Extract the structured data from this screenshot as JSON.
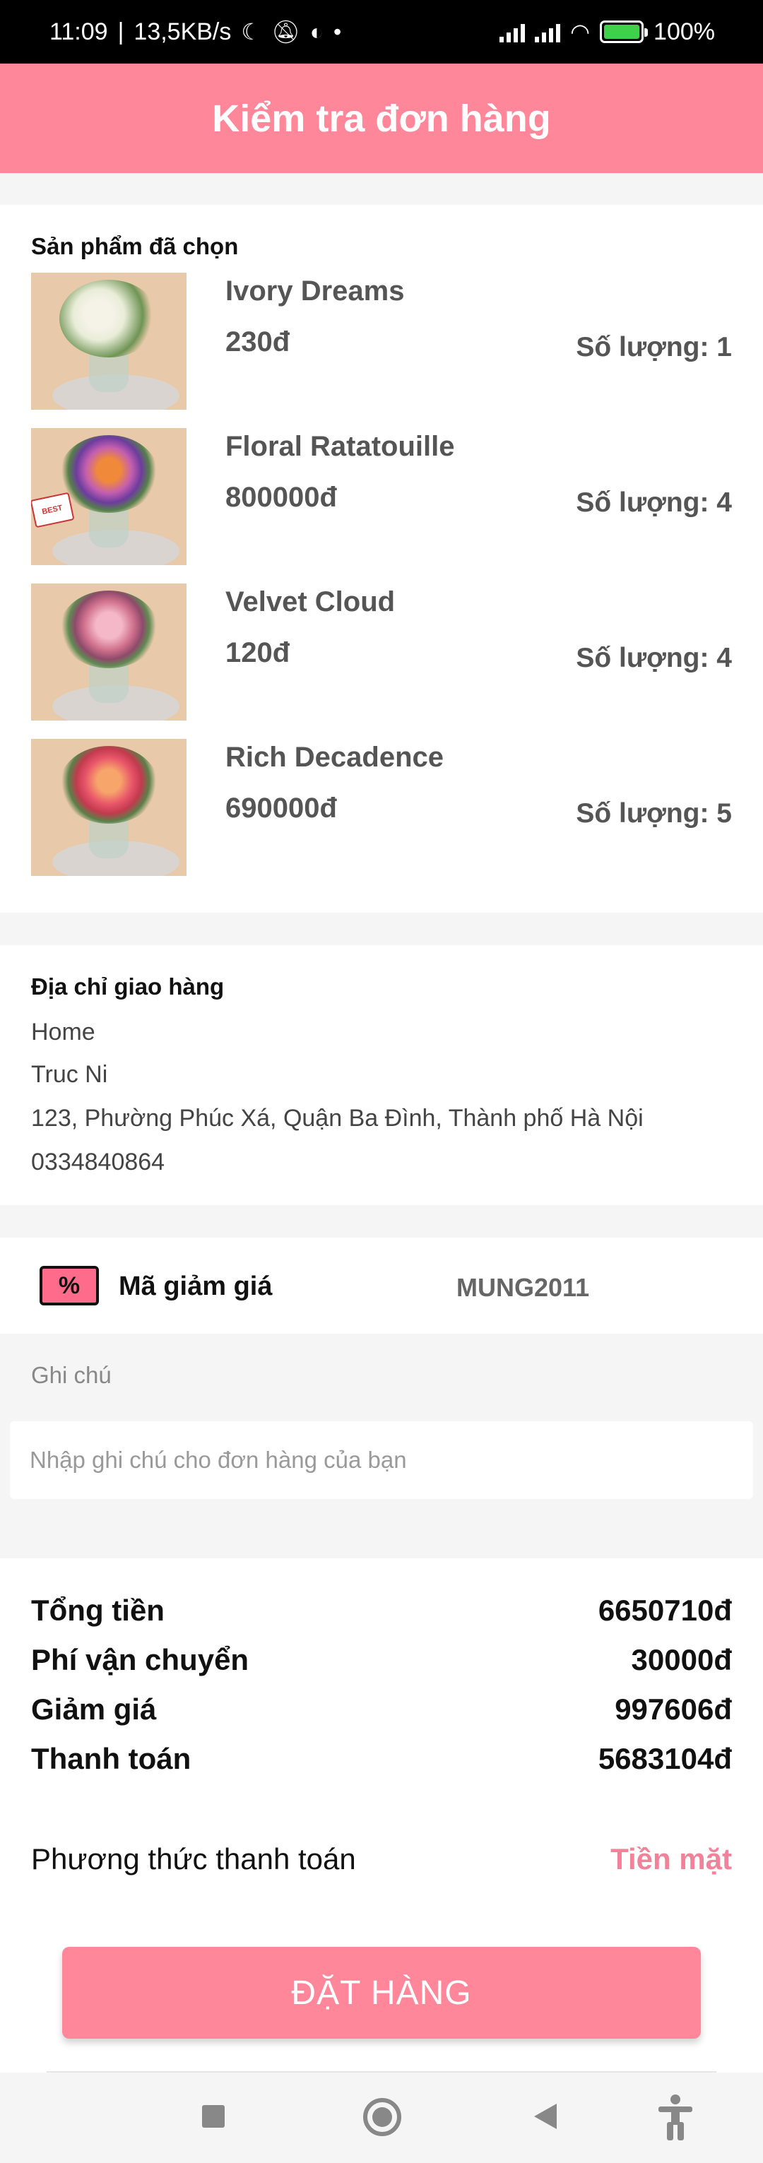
{
  "status_bar": {
    "time": "11:09",
    "speed": "13,5KB/s",
    "battery": "100%"
  },
  "header": {
    "title": "Kiểm tra đơn hàng"
  },
  "products": {
    "title": "Sản phẩm đã chọn",
    "qty_prefix": "Số lượng: ",
    "items": [
      {
        "name": "Ivory Dreams",
        "price": "230đ",
        "qty": "Số lượng: 1"
      },
      {
        "name": "Floral Ratatouille",
        "price": "800000đ",
        "qty": "Số lượng: 4"
      },
      {
        "name": "Velvet Cloud",
        "price": "120đ",
        "qty": "Số lượng: 4"
      },
      {
        "name": "Rich Decadence",
        "price": "690000đ",
        "qty": "Số lượng: 5"
      }
    ]
  },
  "address": {
    "title": "Địa chỉ giao hàng",
    "label": "Home",
    "recipient": "Truc Ni",
    "street": "123, Phường Phúc Xá, Quận Ba Đình, Thành phố Hà Nội",
    "phone": "0334840864"
  },
  "coupon": {
    "label": "Mã giảm giá",
    "code": "MUNG2011"
  },
  "note": {
    "label": "Ghi chú",
    "placeholder": "Nhập ghi chú cho đơn hàng của bạn"
  },
  "summary": {
    "total_label": "Tổng tiền",
    "total_value": "6650710đ",
    "shipping_label": "Phí vận chuyển",
    "shipping_value": "30000đ",
    "discount_label": "Giảm giá",
    "discount_value": "997606đ",
    "payment_label": "Thanh toán",
    "payment_value": "5683104đ"
  },
  "payment_method": {
    "label": "Phương thức thanh toán",
    "value": "Tiền mặt"
  },
  "order_button": {
    "label": "ĐẶT HÀNG"
  },
  "colors": {
    "accent": "#ff8799",
    "payment_method": "#f0839a"
  }
}
